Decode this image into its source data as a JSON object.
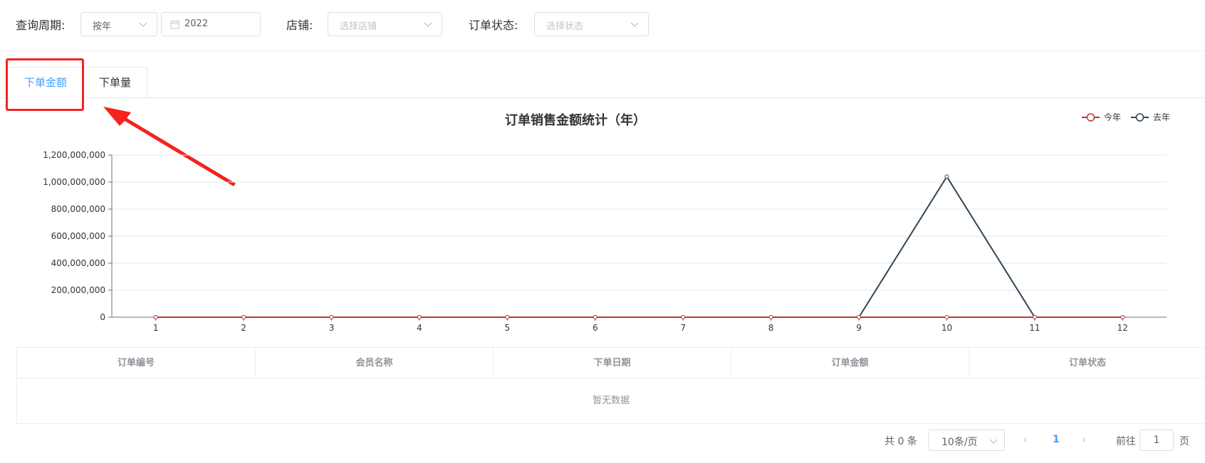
{
  "filters": {
    "period_label": "查询周期:",
    "period_value": "按年",
    "year_value": "2022",
    "store_label": "店铺:",
    "store_placeholder": "选择店铺",
    "status_label": "订单状态:",
    "status_placeholder": "选择状态"
  },
  "tabs": [
    {
      "label": "下单金额",
      "active": true
    },
    {
      "label": "下单量",
      "active": false
    }
  ],
  "colors": {
    "accent": "#409eff",
    "this_year": "#c23531",
    "last_year": "#2f4554",
    "annotation": "#f5221e"
  },
  "chart_data": {
    "type": "line",
    "title": "订单销售金额统计（年）",
    "categories": [
      "1",
      "2",
      "3",
      "4",
      "5",
      "6",
      "7",
      "8",
      "9",
      "10",
      "11",
      "12"
    ],
    "ylim": [
      0,
      1200000000
    ],
    "yticks": [
      "0",
      "200,000,000",
      "400,000,000",
      "600,000,000",
      "800,000,000",
      "1,000,000,000",
      "1,200,000,000"
    ],
    "grid": true,
    "legend_position": "top-right",
    "series": [
      {
        "name": "今年",
        "color": "#c23531",
        "values": [
          0,
          0,
          0,
          0,
          0,
          0,
          0,
          0,
          0,
          0,
          0,
          0
        ]
      },
      {
        "name": "去年",
        "color": "#2f4554",
        "values": [
          0,
          0,
          0,
          0,
          0,
          0,
          0,
          0,
          0,
          1040000000,
          0,
          0
        ]
      }
    ]
  },
  "table": {
    "columns": [
      "订单编号",
      "会员名称",
      "下单日期",
      "订单金额",
      "订单状态"
    ],
    "empty_text": "暂无数据"
  },
  "pagination": {
    "total_text": "共 0 条",
    "page_size": "10条/页",
    "current_page": "1",
    "goto_label": "前往",
    "goto_value": "1",
    "page_suffix": "页"
  }
}
